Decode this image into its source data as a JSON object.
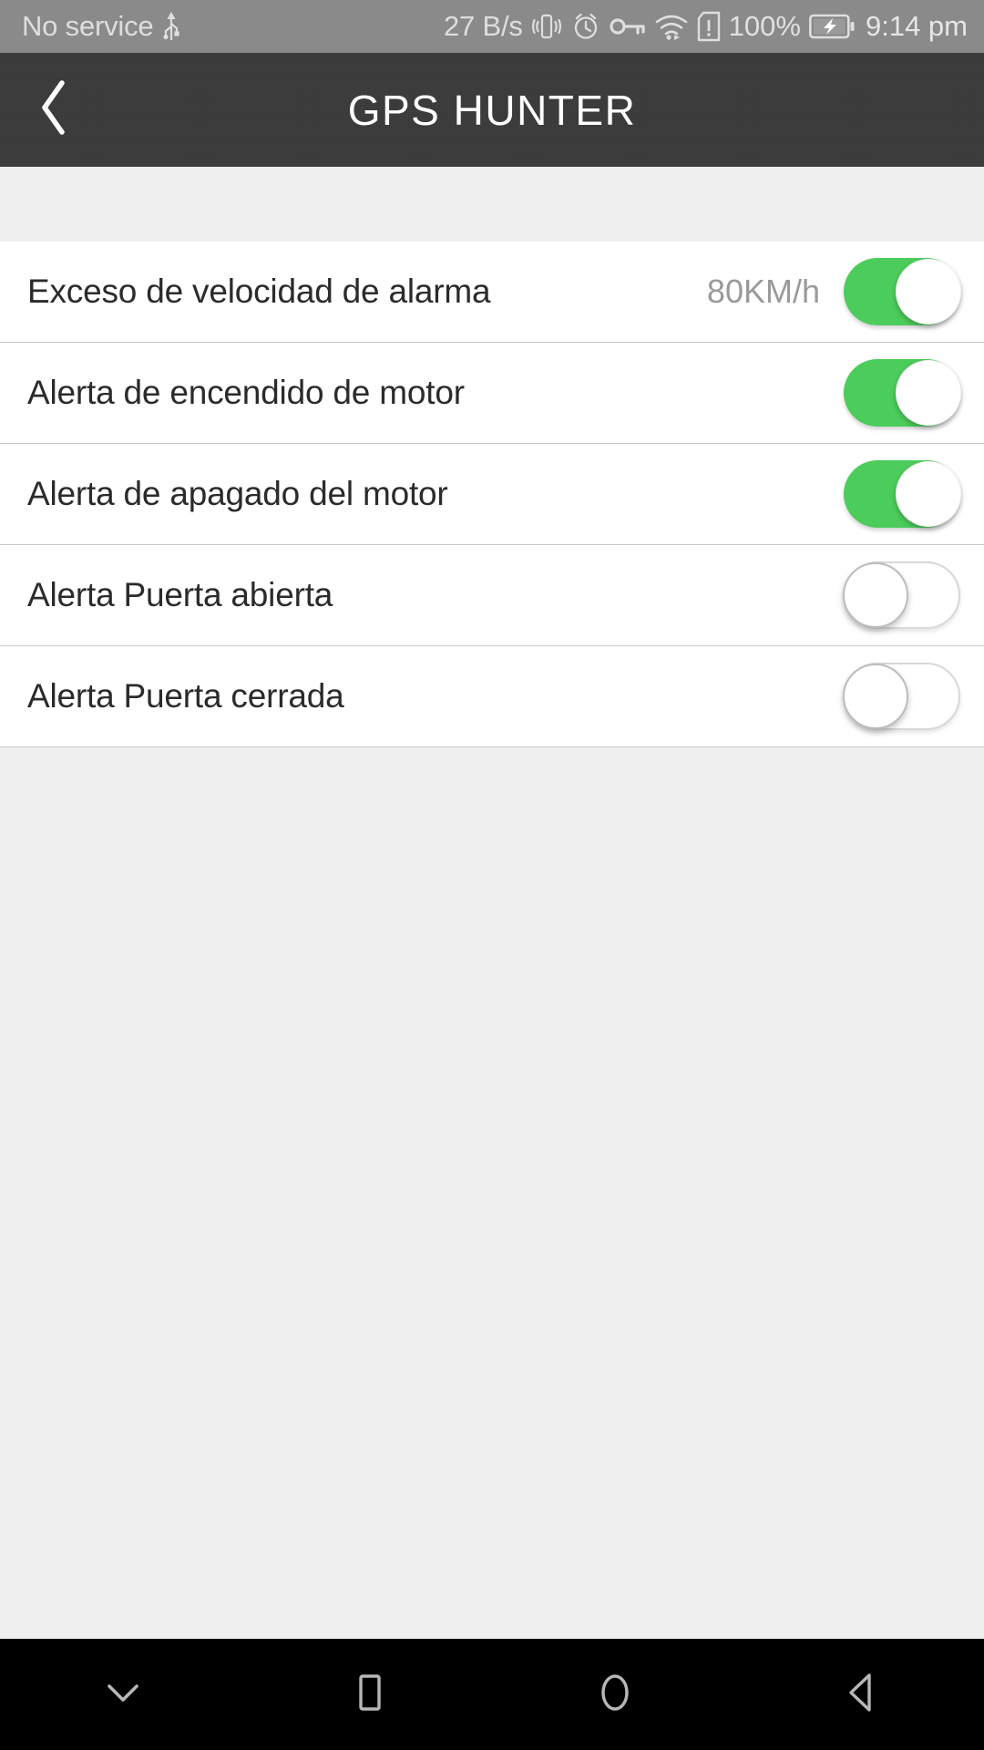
{
  "status_bar": {
    "carrier": "No service",
    "usb_icon": "usb-icon",
    "network_speed": "27 B/s",
    "vibrate_icon": "vibrate-icon",
    "alarm_icon": "alarm-clock-icon",
    "vpn_key_icon": "vpn-key-icon",
    "wifi_icon": "wifi-icon",
    "sim_alert_icon": "sim-card-alert-icon",
    "battery_percent": "100%",
    "battery_icon": "battery-charging-icon",
    "time": "9:14 pm",
    "background_color": "#8a8a8a",
    "text_color": "#dedede"
  },
  "header": {
    "back_icon": "chevron-left-icon",
    "title": "GPS HUNTER",
    "background_color": "#3b3b3b",
    "title_color": "#ffffff"
  },
  "settings": {
    "accent_on_color": "#4ccc5b",
    "off_track_color": "#ffffff",
    "divider_color": "#c9c9c9",
    "rows": [
      {
        "label": "Exceso de velocidad de alarma",
        "value": "80KM/h",
        "state": "on",
        "toggle_name": "toggle-speeding-alarm"
      },
      {
        "label": "Alerta de encendido de motor",
        "value": "",
        "state": "on",
        "toggle_name": "toggle-engine-on-alert"
      },
      {
        "label": "Alerta de apagado del motor",
        "value": "",
        "state": "on",
        "toggle_name": "toggle-engine-off-alert"
      },
      {
        "label": "Alerta Puerta abierta",
        "value": "",
        "state": "off",
        "toggle_name": "toggle-door-open-alert"
      },
      {
        "label": "Alerta Puerta cerrada",
        "value": "",
        "state": "off",
        "toggle_name": "toggle-door-closed-alert"
      }
    ]
  },
  "nav_bar": {
    "background_color": "#000000",
    "icon_color": "#b7b7b7",
    "buttons": [
      {
        "name": "hide-keyboard-icon",
        "label": ""
      },
      {
        "name": "recents-square-icon",
        "label": ""
      },
      {
        "name": "home-circle-icon",
        "label": ""
      },
      {
        "name": "back-triangle-icon",
        "label": ""
      }
    ]
  }
}
